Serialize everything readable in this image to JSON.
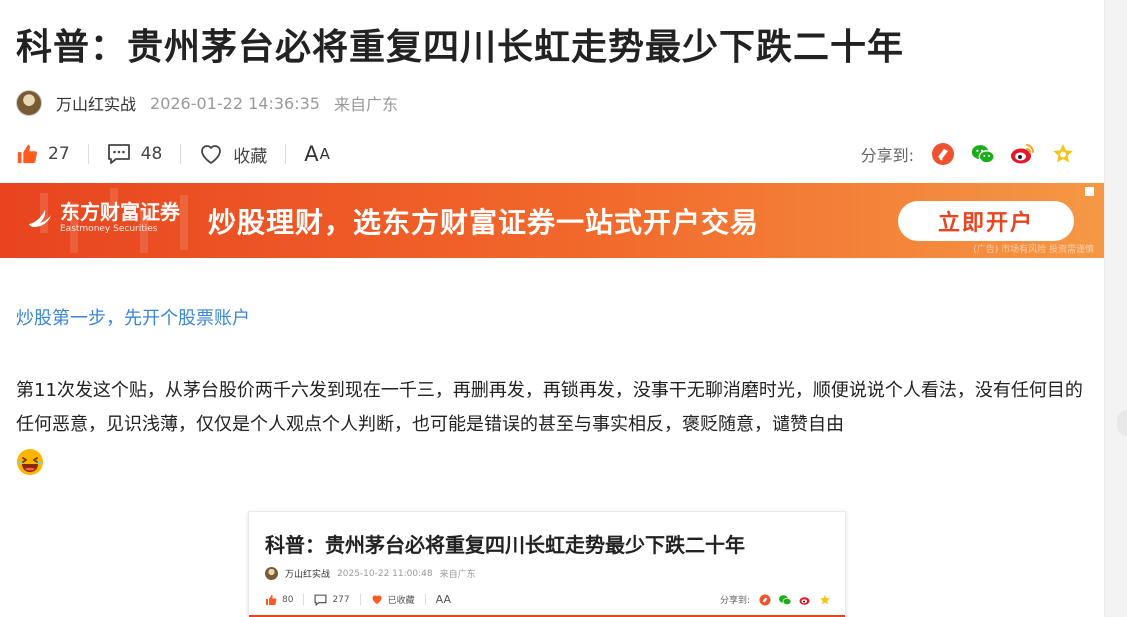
{
  "article": {
    "title": "科普：贵州茅台必将重复四川长虹走势最少下跌二十年",
    "author": "万山红实战",
    "time": "2026-01-22 14:36:35",
    "from": "来自广东"
  },
  "actions": {
    "like_count": "27",
    "comment_count": "48",
    "collect_label": "收藏",
    "font_big": "A",
    "font_small": "A",
    "share_label": "分享到:",
    "share_icons": [
      "toutiao-icon",
      "wechat-icon",
      "weibo-icon",
      "favorite-star-icon"
    ]
  },
  "banner": {
    "logo_cn": "东方财富证券",
    "logo_en": "Eastmoney Securities",
    "slogan": "炒股理财，选东方财富证券一站式开户交易",
    "cta": "立即开户",
    "note": "(广告) 市场有风险 投资需谨慎",
    "colors": {
      "start": "#e8441f",
      "end": "#f59845"
    }
  },
  "lead_link": "炒股第一步，先开个股票账户",
  "body": {
    "paragraph": "第11次发这个贴，从茅台股价两千六发到现在一千三，再删再发，再锁再发，没事干无聊消磨时光，顺便说说个人看法，没有任何目的任何恶意，见识浅薄，仅仅是个人观点个人判断，也可能是错误的甚至与事实相反，褒贬随意，谴赞自由",
    "emoji": "laughing-emoji"
  },
  "embed": {
    "title": "科普：贵州茅台必将重复四川长虹走势最少下跌二十年",
    "author": "万山红实战",
    "time": "2025-10-22 11:00:48",
    "from": "来自广东",
    "like_count": "80",
    "comment_count": "277",
    "collect_label": "已收藏",
    "font_label": "AA",
    "share_label": "分享到:"
  },
  "colors": {
    "accent": "#e8441f",
    "link": "#3b86d6",
    "like": "#ff5a1f",
    "wechat": "#1aad19",
    "weibo": "#e6162d",
    "star": "#f5c518"
  }
}
